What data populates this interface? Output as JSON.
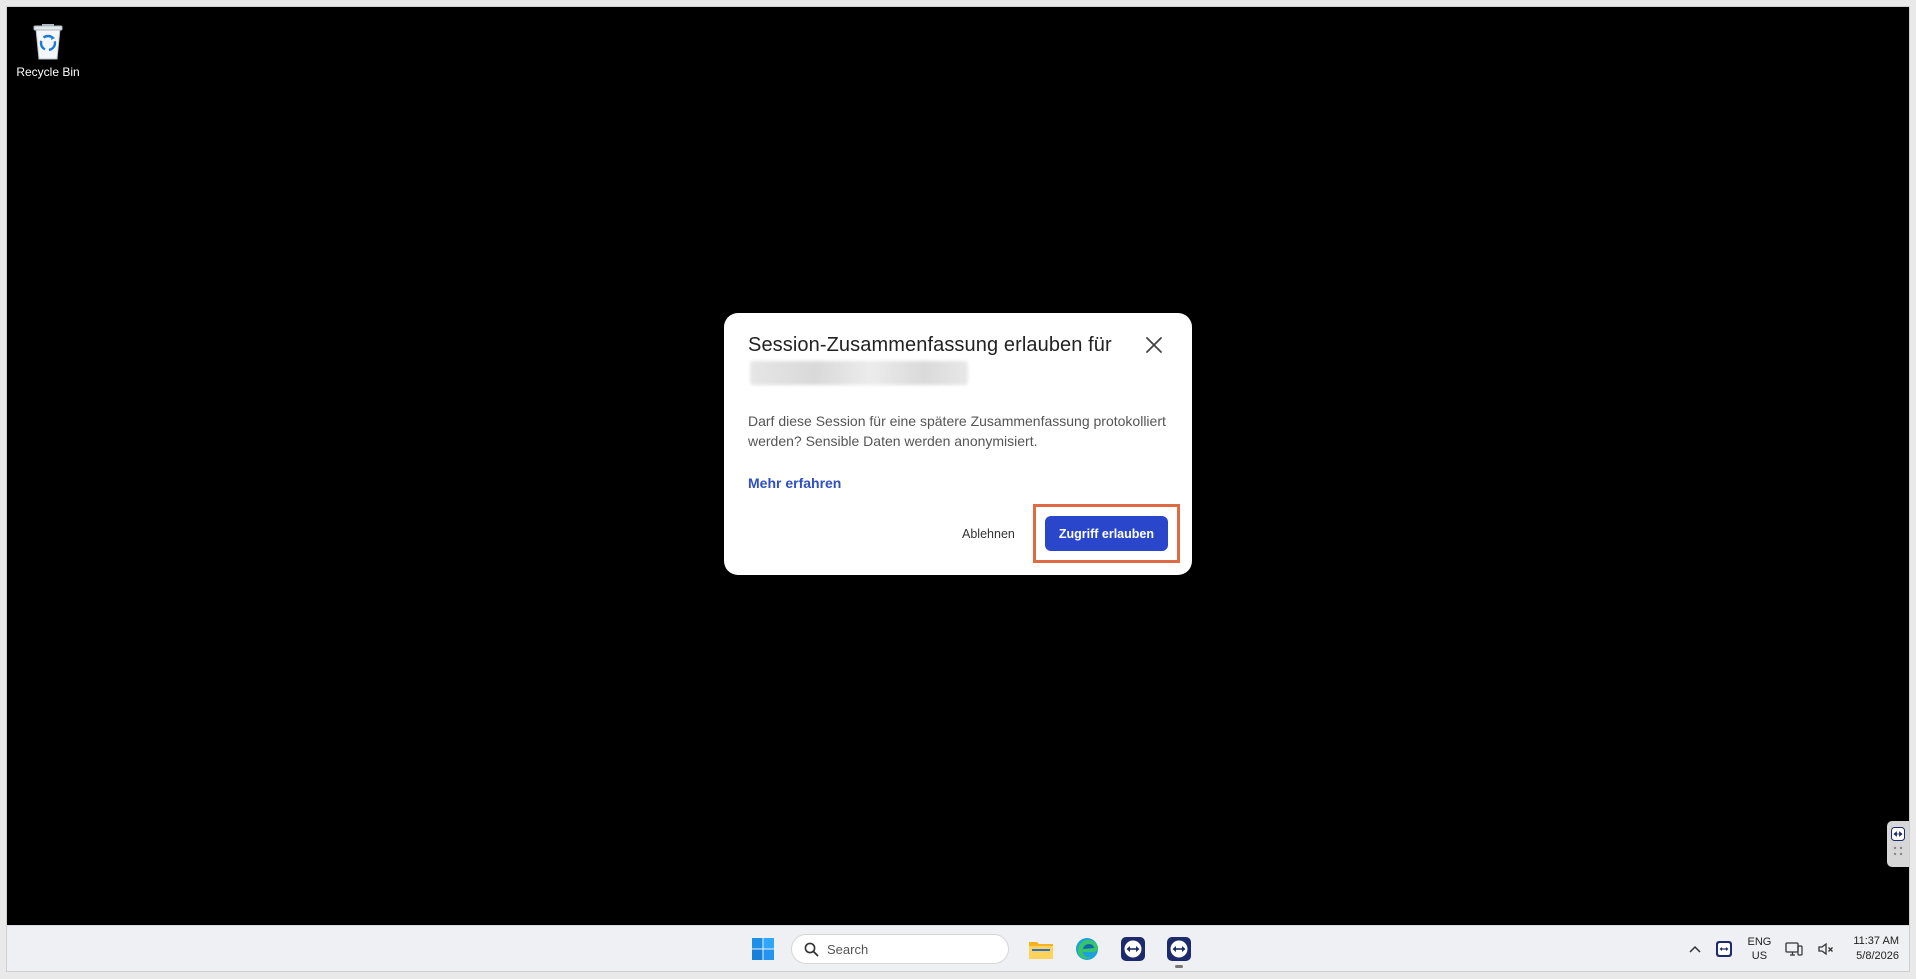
{
  "desktop": {
    "icons": [
      {
        "label": "Recycle Bin",
        "icon": "recycle-bin-icon"
      }
    ]
  },
  "dialog": {
    "title": "Session-Zusammenfassung erlauben für",
    "title_redacted": true,
    "body": "Darf diese Session für eine spätere Zusammenfassung protokolliert werden? Sensible Daten werden anonymisiert.",
    "learn_more": "Mehr erfahren",
    "decline_label": "Ablehnen",
    "allow_label": "Zugriff erlauben",
    "close_icon": "close-icon",
    "colors": {
      "primary": "#2a47cc",
      "link": "#2f4fc4",
      "highlight": "#e06a43"
    }
  },
  "taskbar": {
    "start_icon": "windows-start-icon",
    "search_placeholder": "Search",
    "apps": [
      {
        "name": "file-explorer-icon"
      },
      {
        "name": "edge-browser-icon"
      },
      {
        "name": "teamviewer-icon"
      },
      {
        "name": "teamviewer-icon",
        "active": true
      }
    ],
    "tray": {
      "language_top": "ENG",
      "language_bottom": "US",
      "time": "11:37 AM",
      "date": "5/8/2026"
    }
  }
}
